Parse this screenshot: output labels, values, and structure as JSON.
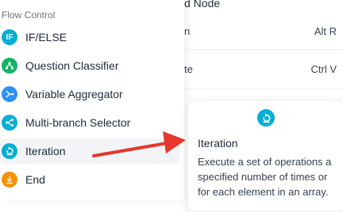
{
  "context_menu": {
    "title_fragment": "d Node",
    "rows": [
      {
        "label_fragment": "n",
        "shortcut": "Alt R"
      },
      {
        "label_fragment": "te",
        "shortcut": "Ctrl V"
      }
    ]
  },
  "panel": {
    "section_title": "Flow Control",
    "items": [
      {
        "label": "IF/ELSE",
        "icon": "if-else-icon",
        "icon_text": "IF",
        "color": "#06aed4"
      },
      {
        "label": "Question Classifier",
        "icon": "question-classifier-icon",
        "color": "#16b364"
      },
      {
        "label": "Variable Aggregator",
        "icon": "variable-aggregator-icon",
        "color": "#2e90fa"
      },
      {
        "label": "Multi-branch Selector",
        "icon": "multi-branch-selector-icon",
        "color": "#06aed4"
      },
      {
        "label": "Iteration",
        "icon": "iteration-icon",
        "color": "#06aed4",
        "selected": true
      },
      {
        "label": "End",
        "icon": "end-icon",
        "color": "#f79009"
      }
    ]
  },
  "tooltip": {
    "icon": "iteration-icon",
    "title": "Iteration",
    "description": "Execute a set of operations a specified number of times or for each element in an array."
  },
  "annotation": {
    "arrow_color": "#e5372b"
  }
}
